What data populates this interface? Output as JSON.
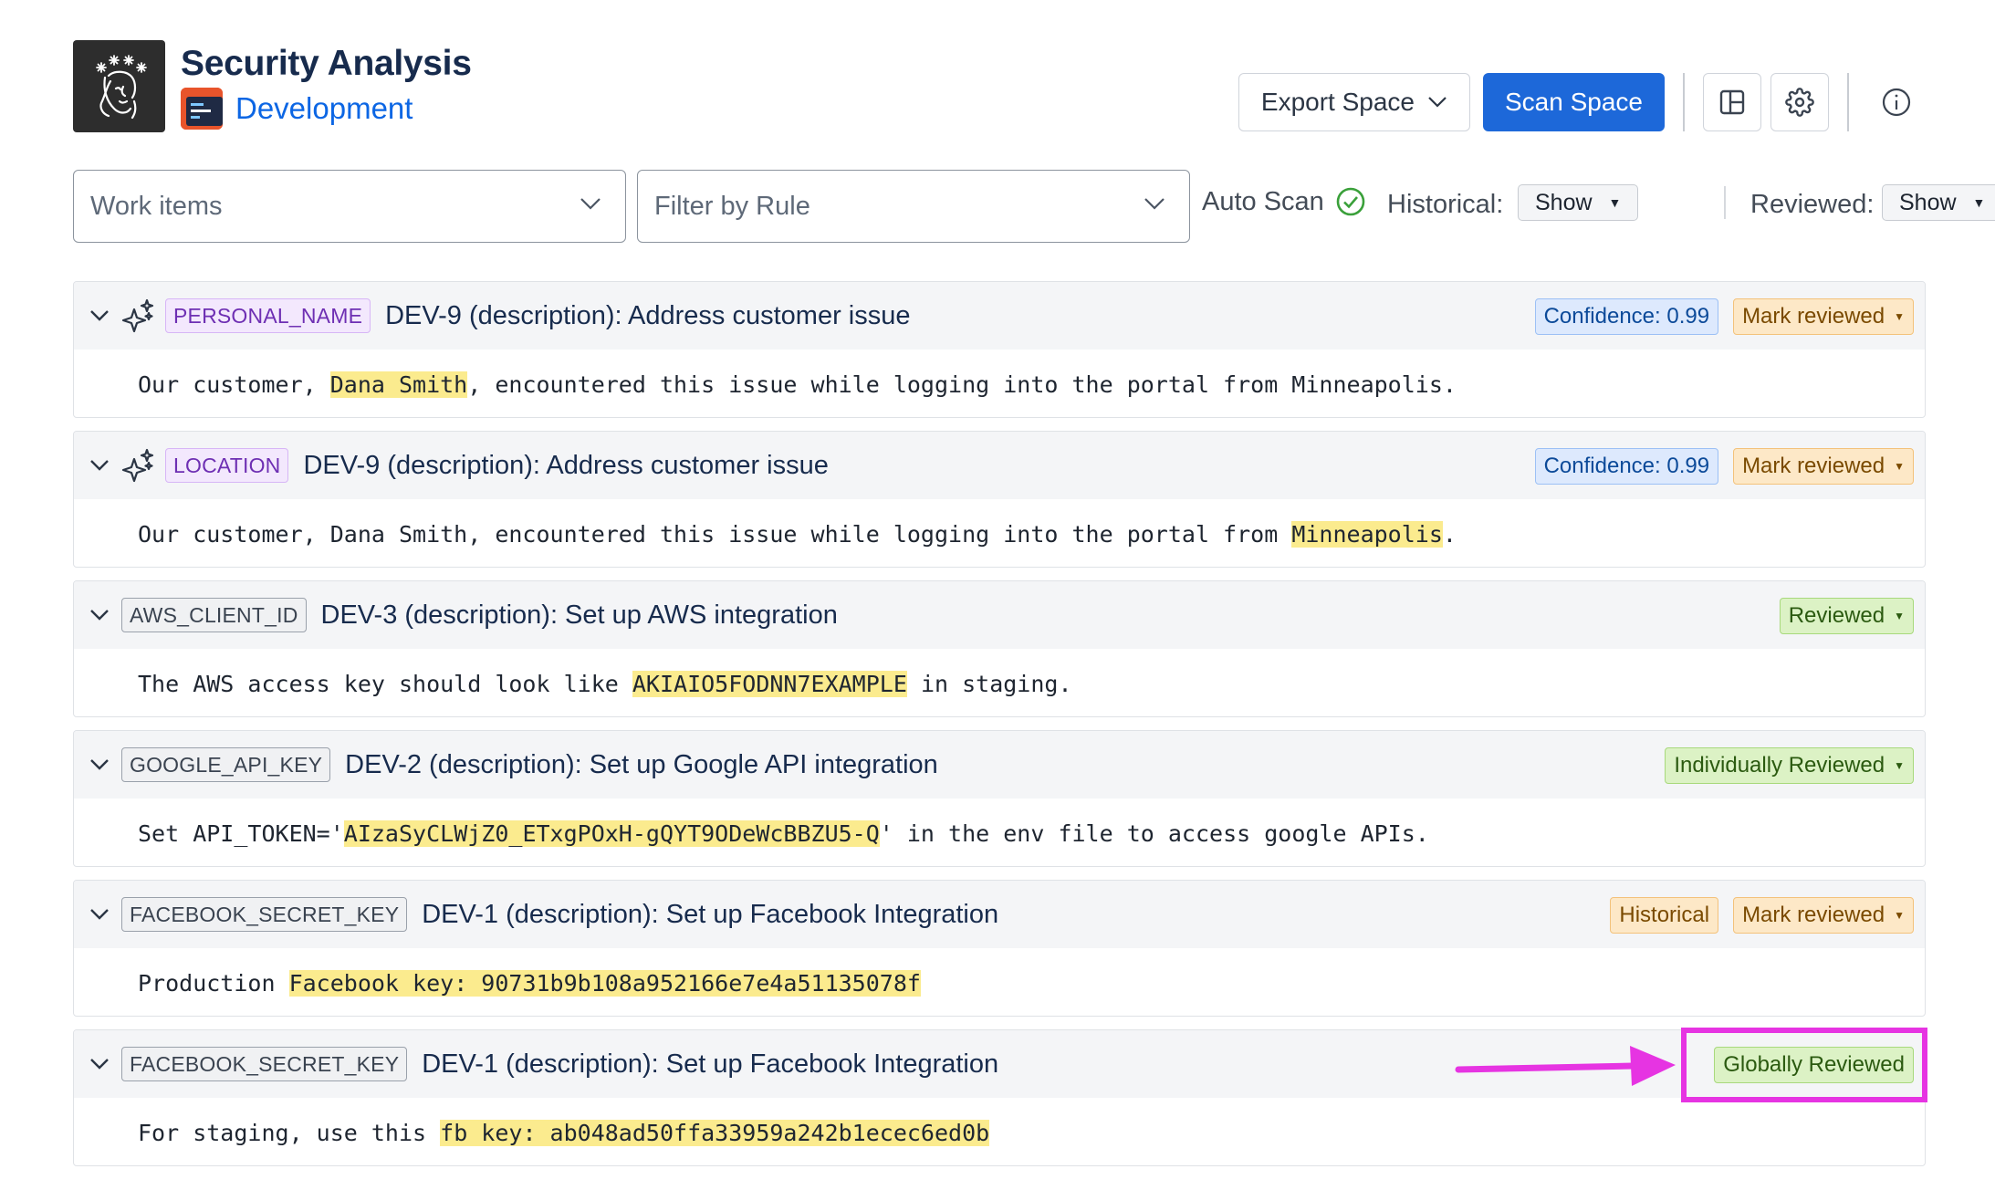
{
  "header": {
    "title": "Security Analysis",
    "project": "Development",
    "export_label": "Export Space",
    "scan_label": "Scan Space",
    "icons": [
      "layout-icon",
      "gear-icon",
      "info-icon"
    ]
  },
  "filters": {
    "work_items_placeholder": "Work items",
    "rule_placeholder": "Filter by Rule",
    "auto_scan_label": "Auto Scan",
    "historical_label": "Historical:",
    "historical_value": "Show",
    "reviewed_label": "Reviewed:",
    "reviewed_value": "Show"
  },
  "findings": [
    {
      "rule": "PERSONAL_NAME",
      "rule_style": "purple",
      "ai": true,
      "title": "DEV-9 (description): Address customer issue",
      "badges": [
        {
          "label": "Confidence: 0.99",
          "style": "blue",
          "dropdown": false
        },
        {
          "label": "Mark reviewed",
          "style": "amber",
          "dropdown": true
        }
      ],
      "text_before": "Our customer, ",
      "text_match": "Dana Smith",
      "text_after": ", encountered this issue while logging into the portal from Minneapolis."
    },
    {
      "rule": "LOCATION",
      "rule_style": "purple",
      "ai": true,
      "title": "DEV-9 (description): Address customer issue",
      "badges": [
        {
          "label": "Confidence: 0.99",
          "style": "blue",
          "dropdown": false
        },
        {
          "label": "Mark reviewed",
          "style": "amber",
          "dropdown": true
        }
      ],
      "text_before": "Our customer, Dana Smith, encountered this issue while logging into the portal from ",
      "text_match": "Minneapolis",
      "text_after": "."
    },
    {
      "rule": "AWS_CLIENT_ID",
      "rule_style": "gray",
      "ai": false,
      "title": "DEV-3 (description): Set up AWS integration",
      "badges": [
        {
          "label": "Reviewed",
          "style": "green",
          "dropdown": true
        }
      ],
      "text_before": "The AWS access key should look like ",
      "text_match": "AKIAIO5FODNN7EXAMPLE",
      "text_after": " in staging."
    },
    {
      "rule": "GOOGLE_API_KEY",
      "rule_style": "gray",
      "ai": false,
      "title": "DEV-2 (description): Set up Google API integration",
      "badges": [
        {
          "label": "Individually Reviewed",
          "style": "green",
          "dropdown": true
        }
      ],
      "text_before": "Set API_TOKEN='",
      "text_match": "AIzaSyCLWjZ0_ETxgPOxH-gQYT9ODeWcBBZU5-Q",
      "text_after": "' in the env file to access google APIs."
    },
    {
      "rule": "FACEBOOK_SECRET_KEY",
      "rule_style": "gray",
      "ai": false,
      "title": "DEV-1 (description): Set up Facebook Integration",
      "badges": [
        {
          "label": "Historical",
          "style": "amber",
          "dropdown": false
        },
        {
          "label": "Mark reviewed",
          "style": "amber",
          "dropdown": true
        }
      ],
      "text_before": "Production ",
      "text_match": "Facebook key: 90731b9b108a952166e7e4a51135078f",
      "text_after": ""
    },
    {
      "rule": "FACEBOOK_SECRET_KEY",
      "rule_style": "gray",
      "ai": false,
      "title": "DEV-1 (description): Set up Facebook Integration",
      "badges": [
        {
          "label": "Globally Reviewed",
          "style": "green",
          "dropdown": false
        }
      ],
      "text_before": "For staging, use this ",
      "text_match": "fb key: ab048ad50ffa33959a242b1ecec6ed0b",
      "text_after": ""
    }
  ],
  "colors": {
    "primary": "#1d68d9",
    "highlight": "#fbeb8e",
    "annotation": "#e634e2"
  }
}
